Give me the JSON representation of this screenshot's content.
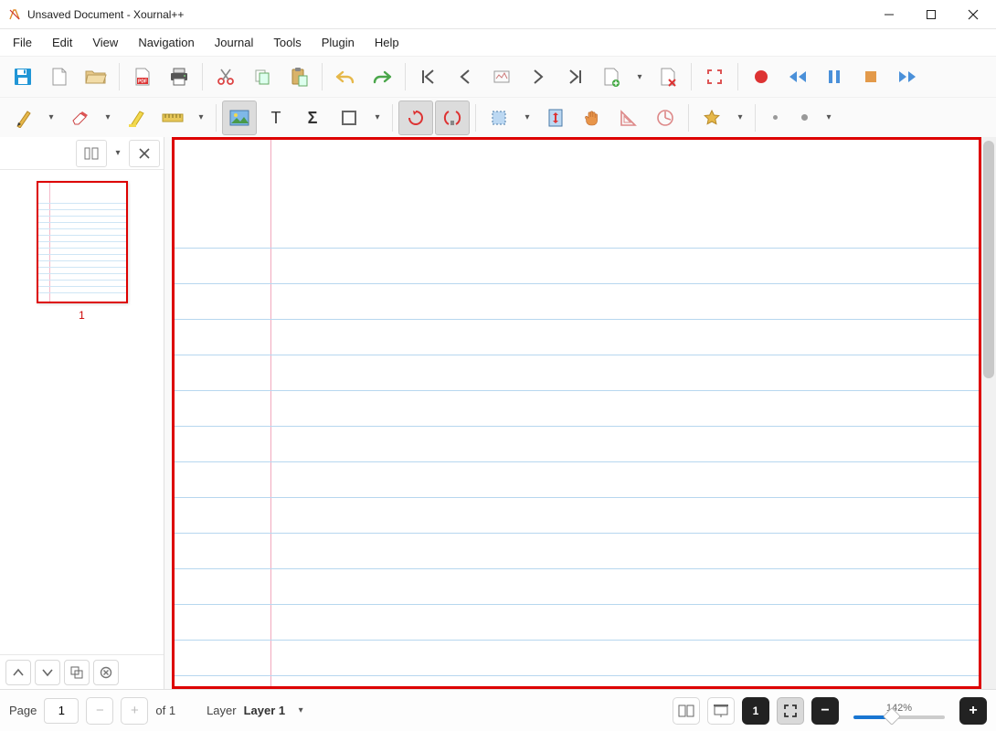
{
  "window": {
    "title": "Unsaved Document - Xournal++"
  },
  "menu": [
    "File",
    "Edit",
    "View",
    "Navigation",
    "Journal",
    "Tools",
    "Plugin",
    "Help"
  ],
  "sidebar": {
    "thumb_label": "1"
  },
  "status": {
    "page_label": "Page",
    "page_value": "1",
    "page_total": "of 1",
    "layer_label": "Layer",
    "layer_value": "Layer 1",
    "zoom": "142%"
  }
}
